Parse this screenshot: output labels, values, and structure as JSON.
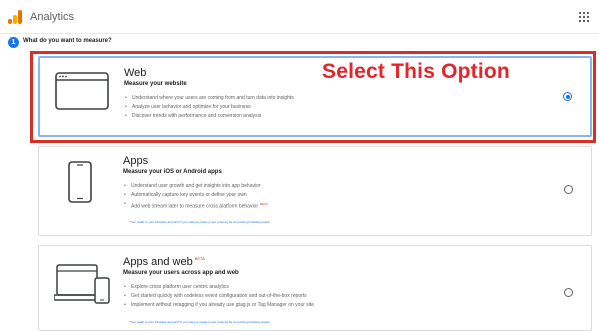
{
  "header": {
    "app_title": "Analytics"
  },
  "step": {
    "number": "1",
    "question": "What do you want to measure?"
  },
  "annotation": {
    "text": "Select This Option",
    "color": "#e3262c"
  },
  "options": [
    {
      "title": "Web",
      "title_badge": "",
      "subtitle": "Measure your website",
      "bullets": [
        "Understand where your users are coming from and turn data into insights",
        "Analyze user behavior and optimize for your business",
        "Discover trends with performance and conversion analysis"
      ],
      "footnote": "",
      "selected": true,
      "icon": "browser-window-icon"
    },
    {
      "title": "Apps",
      "title_badge": "",
      "subtitle": "Measure your iOS or Android apps",
      "bullets": [
        "Understand user growth and get insights into app behavior",
        "Automatically capture key events or define your own",
        "Add web stream later to measure cross platform behavior"
      ],
      "bullet_badge": "BETA",
      "footnote": "*Your (add) to your Firebase account? If you want to create a new property for an existing Firebase project",
      "selected": false,
      "icon": "smartphone-icon"
    },
    {
      "title": "Apps and web",
      "title_badge": "BETA",
      "subtitle": "Measure your users across app and web",
      "bullets": [
        "Explore cross platform user centric analytics",
        "Get started quickly with codeless event configuration and out-of-the-box reports",
        "Implement without retagging if you already use gtag.js or Tag Manager on your site"
      ],
      "footnote": "*Your (add) to your Firebase account? If you want to create a new property for an existing Firebase project",
      "selected": false,
      "icon": "laptop-and-phone-icon"
    }
  ],
  "colors": {
    "accent": "#1a73e8",
    "selected_border": "#8ab4f8",
    "highlight_box": "#d93025"
  }
}
